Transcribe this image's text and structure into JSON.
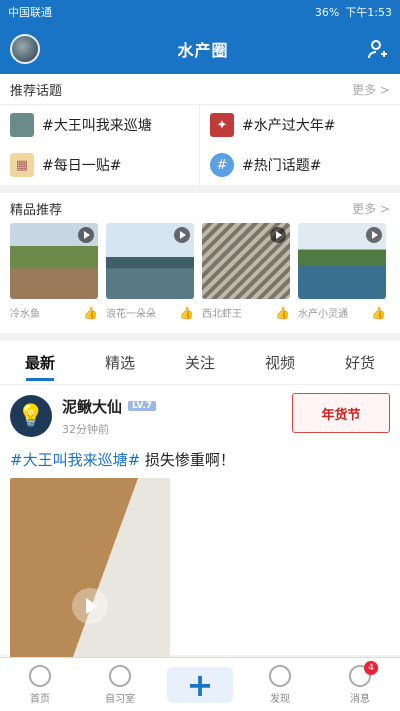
{
  "status": {
    "carrier": "中国联通",
    "battery": "36%",
    "time": "下午1:53"
  },
  "header": {
    "title": "水产圈"
  },
  "recommend": {
    "title": "推荐话题",
    "more": "更多 >",
    "items": [
      {
        "label": "#大王叫我来巡塘",
        "icon": "pond-image-icon"
      },
      {
        "label": "#水产过大年#",
        "icon": "badge-icon"
      },
      {
        "label": "#每日一贴#",
        "icon": "calendar-icon"
      },
      {
        "label": "#热门话题#",
        "icon": "hash-icon"
      }
    ]
  },
  "featured": {
    "title": "精品推荐",
    "more": "更多 >",
    "items": [
      {
        "label": "冷水鱼"
      },
      {
        "label": "浪花一朵朵"
      },
      {
        "label": "西北虾王"
      },
      {
        "label": "水产小灵通"
      }
    ]
  },
  "tabs": [
    "最新",
    "精选",
    "关注",
    "视频",
    "好货"
  ],
  "post": {
    "username": "泥鳅大仙",
    "level": "LV.7",
    "time": "32分钟前",
    "badge": "年货节",
    "tag": "#大王叫我来巡塘#",
    "text": " 损失惨重啊！"
  },
  "bottom_nav": [
    {
      "label": "首页"
    },
    {
      "label": "自习室"
    },
    {
      "label": ""
    },
    {
      "label": "发现"
    },
    {
      "label": "消息",
      "badge": "4"
    }
  ],
  "colors": {
    "brand": "#1a74c5",
    "badge_red": "#e23"
  }
}
